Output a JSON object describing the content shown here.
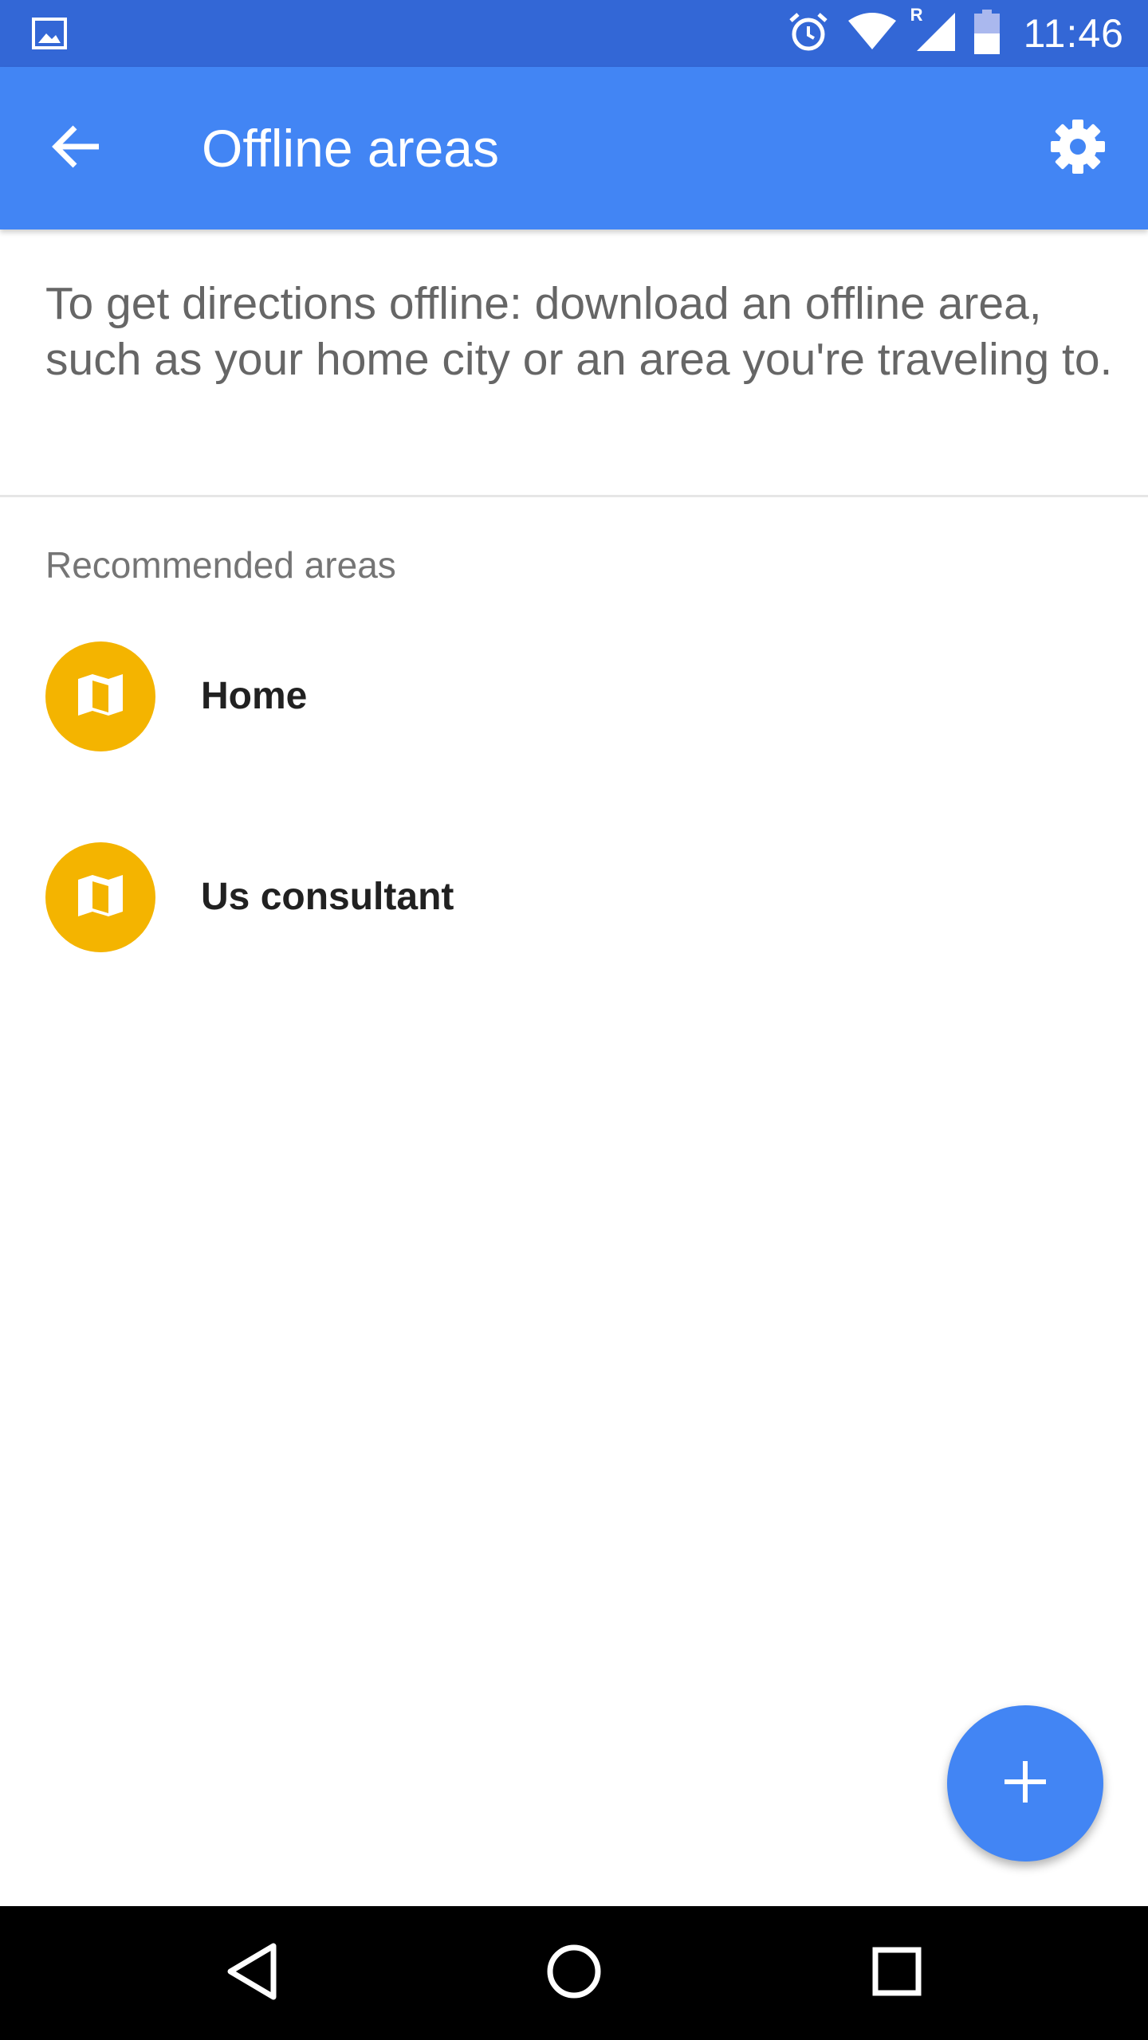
{
  "status_bar": {
    "time": "11:46",
    "network_roaming_label": "R",
    "icons": [
      "image-notification-icon",
      "alarm-icon",
      "wifi-icon",
      "cell-signal-icon",
      "battery-icon"
    ]
  },
  "app_bar": {
    "title": "Offline areas",
    "back_icon": "arrow-back-icon",
    "settings_icon": "gear-icon",
    "color": "#4285f4",
    "status_color": "#3367d6"
  },
  "intro": {
    "text": "To get directions offline: download an offline area, such as your home city or an area you're traveling to."
  },
  "recommended": {
    "section_label": "Recommended areas",
    "items": [
      {
        "label": "Home",
        "icon": "map-icon"
      },
      {
        "label": "Us consultant",
        "icon": "map-icon"
      }
    ],
    "avatar_color": "#f4b400"
  },
  "fab": {
    "icon": "plus-icon",
    "color": "#4285f4"
  },
  "nav_bar": {
    "icons": [
      "back-triangle-icon",
      "home-circle-icon",
      "recents-square-icon"
    ]
  }
}
